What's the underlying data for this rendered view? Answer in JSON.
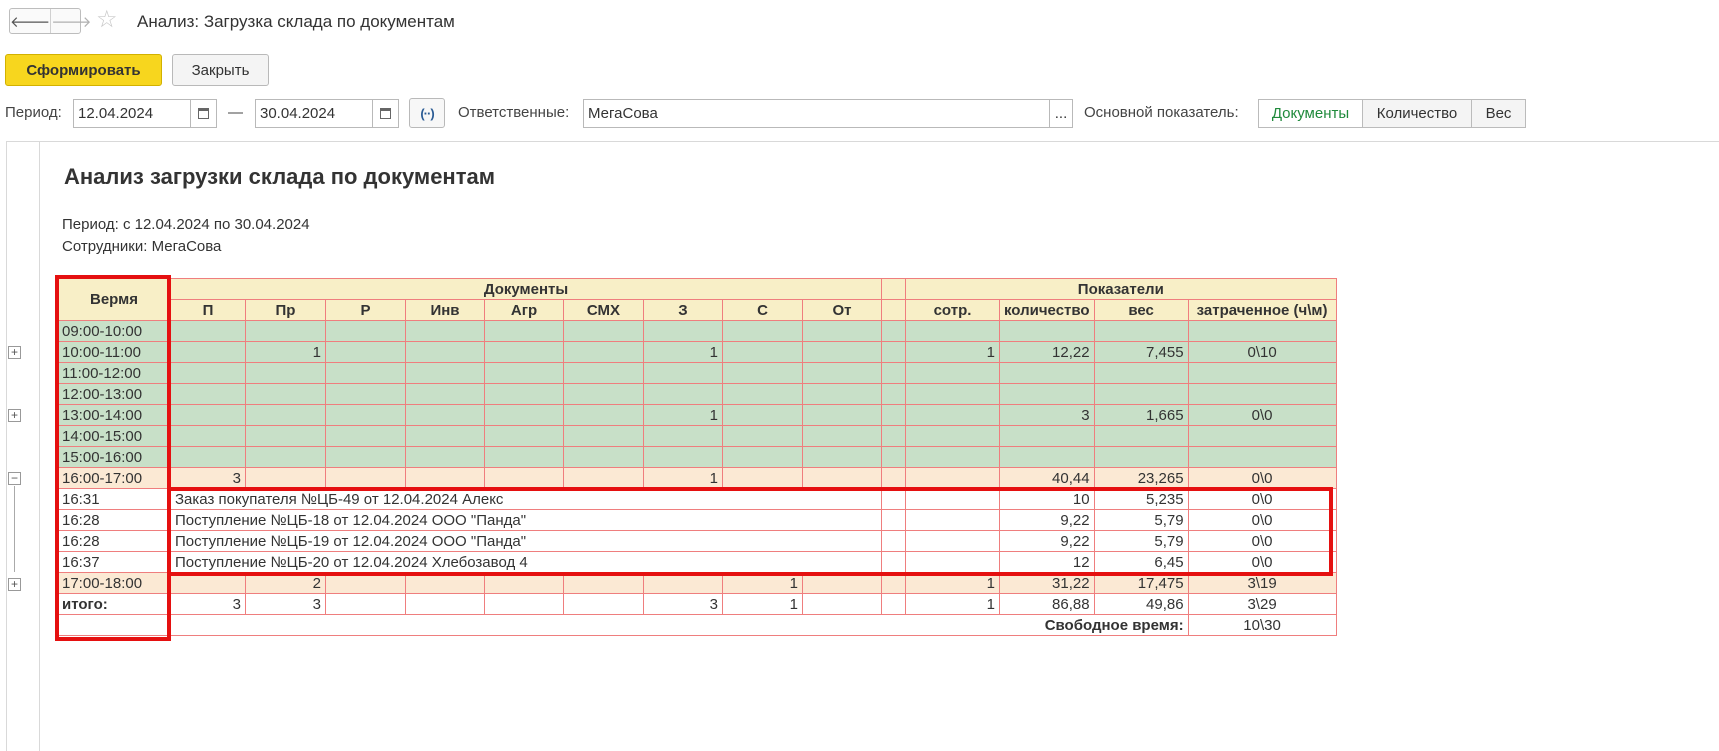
{
  "window": {
    "title": "Анализ: Загрузка склада по документам"
  },
  "icons": {
    "back": "arrow-left-icon",
    "forward": "arrow-right-icon",
    "favorite": "star-icon",
    "calendar": "calendar-icon",
    "period": "period-select-icon",
    "expand": "plus-box-icon",
    "collapse": "minus-box-icon"
  },
  "toolbar": {
    "generate_label": "Сформировать",
    "close_label": "Закрыть"
  },
  "filters": {
    "period_label": "Период:",
    "date_from": "12.04.2024",
    "date_sep": "—",
    "date_to": "30.04.2024",
    "responsible_label": "Ответственные:",
    "responsible_value": "МегаСова",
    "ellipsis": "...",
    "indicator_label": "Основной показатель:",
    "indicators": [
      "Документы",
      "Количество",
      "Вес"
    ],
    "indicator_active": "Документы"
  },
  "report": {
    "title": "Анализ загрузки склада по документам",
    "period_line": "Период: с 12.04.2024 по 30.04.2024",
    "employees_line": "Сотрудники: МегаСова",
    "header_time": "Вермя",
    "group_docs": "Документы",
    "group_indicators": "Показатели",
    "doc_columns": [
      "П",
      "Пр",
      "Р",
      "Инв",
      "Агр",
      "СМХ",
      "З",
      "С",
      "От"
    ],
    "ind_columns": [
      "сотр.",
      "количество",
      "вес",
      "затраченное (ч\\м)"
    ],
    "hour_rows": [
      {
        "time": "09:00-10:00",
        "docs": [
          "",
          "",
          "",
          "",
          "",
          "",
          "",
          "",
          ""
        ],
        "ind": [
          "",
          "",
          "",
          ""
        ]
      },
      {
        "time": "10:00-11:00",
        "docs": [
          "",
          "1",
          "",
          "",
          "",
          "",
          "1",
          "",
          ""
        ],
        "ind": [
          "1",
          "12,22",
          "7,455",
          "0\\10"
        ]
      },
      {
        "time": "11:00-12:00",
        "docs": [
          "",
          "",
          "",
          "",
          "",
          "",
          "",
          "",
          ""
        ],
        "ind": [
          "",
          "",
          "",
          ""
        ]
      },
      {
        "time": "12:00-13:00",
        "docs": [
          "",
          "",
          "",
          "",
          "",
          "",
          "",
          "",
          ""
        ],
        "ind": [
          "",
          "",
          "",
          ""
        ]
      },
      {
        "time": "13:00-14:00",
        "docs": [
          "",
          "",
          "",
          "",
          "",
          "",
          "1",
          "",
          ""
        ],
        "ind": [
          "",
          "3",
          "1,665",
          "0\\0"
        ]
      },
      {
        "time": "14:00-15:00",
        "docs": [
          "",
          "",
          "",
          "",
          "",
          "",
          "",
          "",
          ""
        ],
        "ind": [
          "",
          "",
          "",
          ""
        ]
      },
      {
        "time": "15:00-16:00",
        "docs": [
          "",
          "",
          "",
          "",
          "",
          "",
          "",
          "",
          ""
        ],
        "ind": [
          "",
          "",
          "",
          ""
        ]
      }
    ],
    "expanded_row": {
      "time": "16:00-17:00",
      "docs": [
        "3",
        "",
        "",
        "",
        "",
        "",
        "1",
        "",
        ""
      ],
      "ind": [
        "",
        "40,44",
        "23,265",
        "0\\0"
      ]
    },
    "detail_rows": [
      {
        "time": "16:31",
        "doc": "Заказ покупателя №ЦБ-49 от 12.04.2024 Алекс",
        "qty": "10",
        "weight": "5,235",
        "spent": "0\\0"
      },
      {
        "time": "16:28",
        "doc": "Поступление №ЦБ-18 от 12.04.2024 ООО \"Панда\"",
        "qty": "9,22",
        "weight": "5,79",
        "spent": "0\\0"
      },
      {
        "time": "16:28",
        "doc": "Поступление №ЦБ-19 от 12.04.2024 ООО \"Панда\"",
        "qty": "9,22",
        "weight": "5,79",
        "spent": "0\\0"
      },
      {
        "time": "16:37",
        "doc": "Поступление №ЦБ-20 от 12.04.2024 Хлебозавод 4",
        "qty": "12",
        "weight": "6,45",
        "spent": "0\\0"
      }
    ],
    "after_row": {
      "time": "17:00-18:00",
      "docs": [
        "",
        "2",
        "",
        "",
        "",
        "",
        "",
        "1",
        ""
      ],
      "ind": [
        "1",
        "31,22",
        "17,475",
        "3\\19"
      ]
    },
    "total_row": {
      "label": "итого:",
      "docs": [
        "3",
        "3",
        "",
        "",
        "",
        "",
        "3",
        "1",
        ""
      ],
      "ind": [
        "1",
        "86,88",
        "49,86",
        "3\\29"
      ]
    },
    "free_time_label": "Свободное время:",
    "free_time_value": "10\\30"
  }
}
